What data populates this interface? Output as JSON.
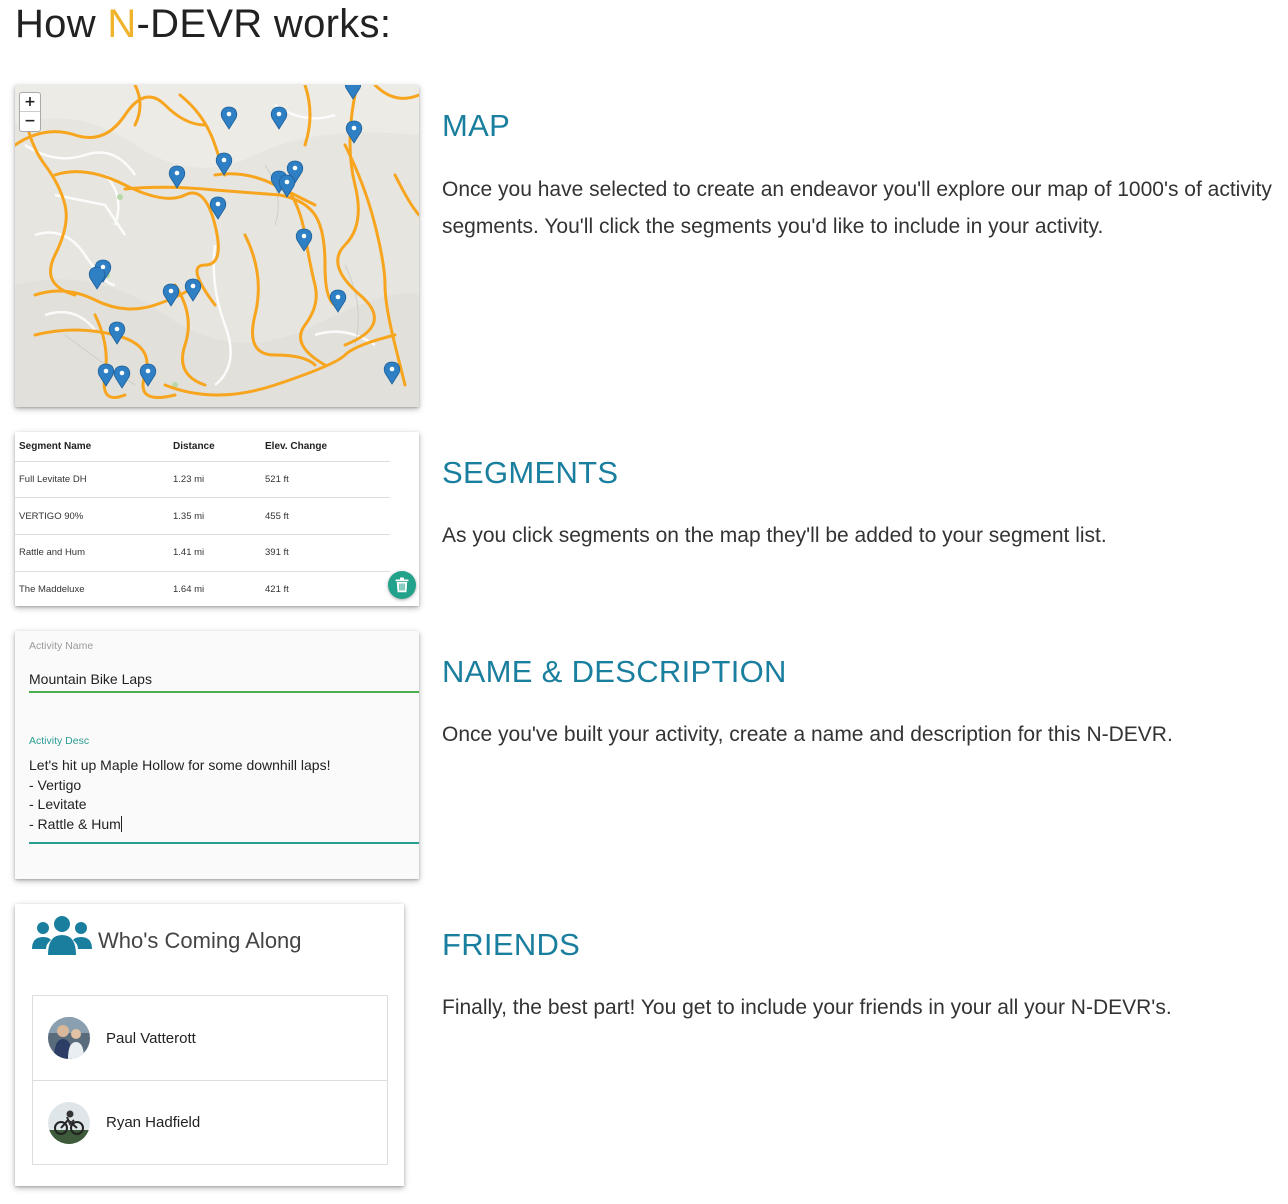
{
  "page": {
    "title_prefix": "How ",
    "title_accent": "N",
    "title_suffix": "-DEVR works:",
    "accent_color": "#f0b32c",
    "heading_color": "#1a7f9e"
  },
  "map": {
    "zoom_in": "+",
    "zoom_out": "−",
    "heading": "MAP",
    "body": "Once you have selected to create an endeavor you'll explore our map of 1000's of activity segments. You'll click the segments you'd like to include in your activity."
  },
  "segments": {
    "heading": "SEGMENTS",
    "body": "As you click segments on the map they'll be added to your segment list.",
    "columns": [
      "Segment Name",
      "Distance",
      "Elev. Change"
    ],
    "rows": [
      [
        "Full Levitate DH",
        "1.23 mi",
        "521 ft"
      ],
      [
        "VERTIGO 90%",
        "1.35 mi",
        "455 ft"
      ],
      [
        "Rattle and Hum",
        "1.41 mi",
        "391 ft"
      ],
      [
        "The Maddeluxe",
        "1.64 mi",
        "421 ft"
      ]
    ],
    "trash_icon": "trash-icon"
  },
  "name_desc": {
    "heading": "NAME & DESCRIPTION",
    "body": "Once you've built your activity, create a name and description for this N-DEVR.",
    "name_label": "Activity Name",
    "name_value": "Mountain Bike Laps",
    "desc_label": "Activity Desc",
    "desc_value": "Let's hit up Maple Hollow for some downhill laps!\n- Vertigo\n- Levitate\n- Rattle & Hum"
  },
  "friends": {
    "heading": "FRIENDS",
    "body": "Finally, the best part! You get to include your friends in your all your N-DEVR's.",
    "card_title": "Who's Coming Along",
    "people": [
      {
        "name": "Paul Vatterott"
      },
      {
        "name": "Ryan Hadfield"
      }
    ]
  }
}
